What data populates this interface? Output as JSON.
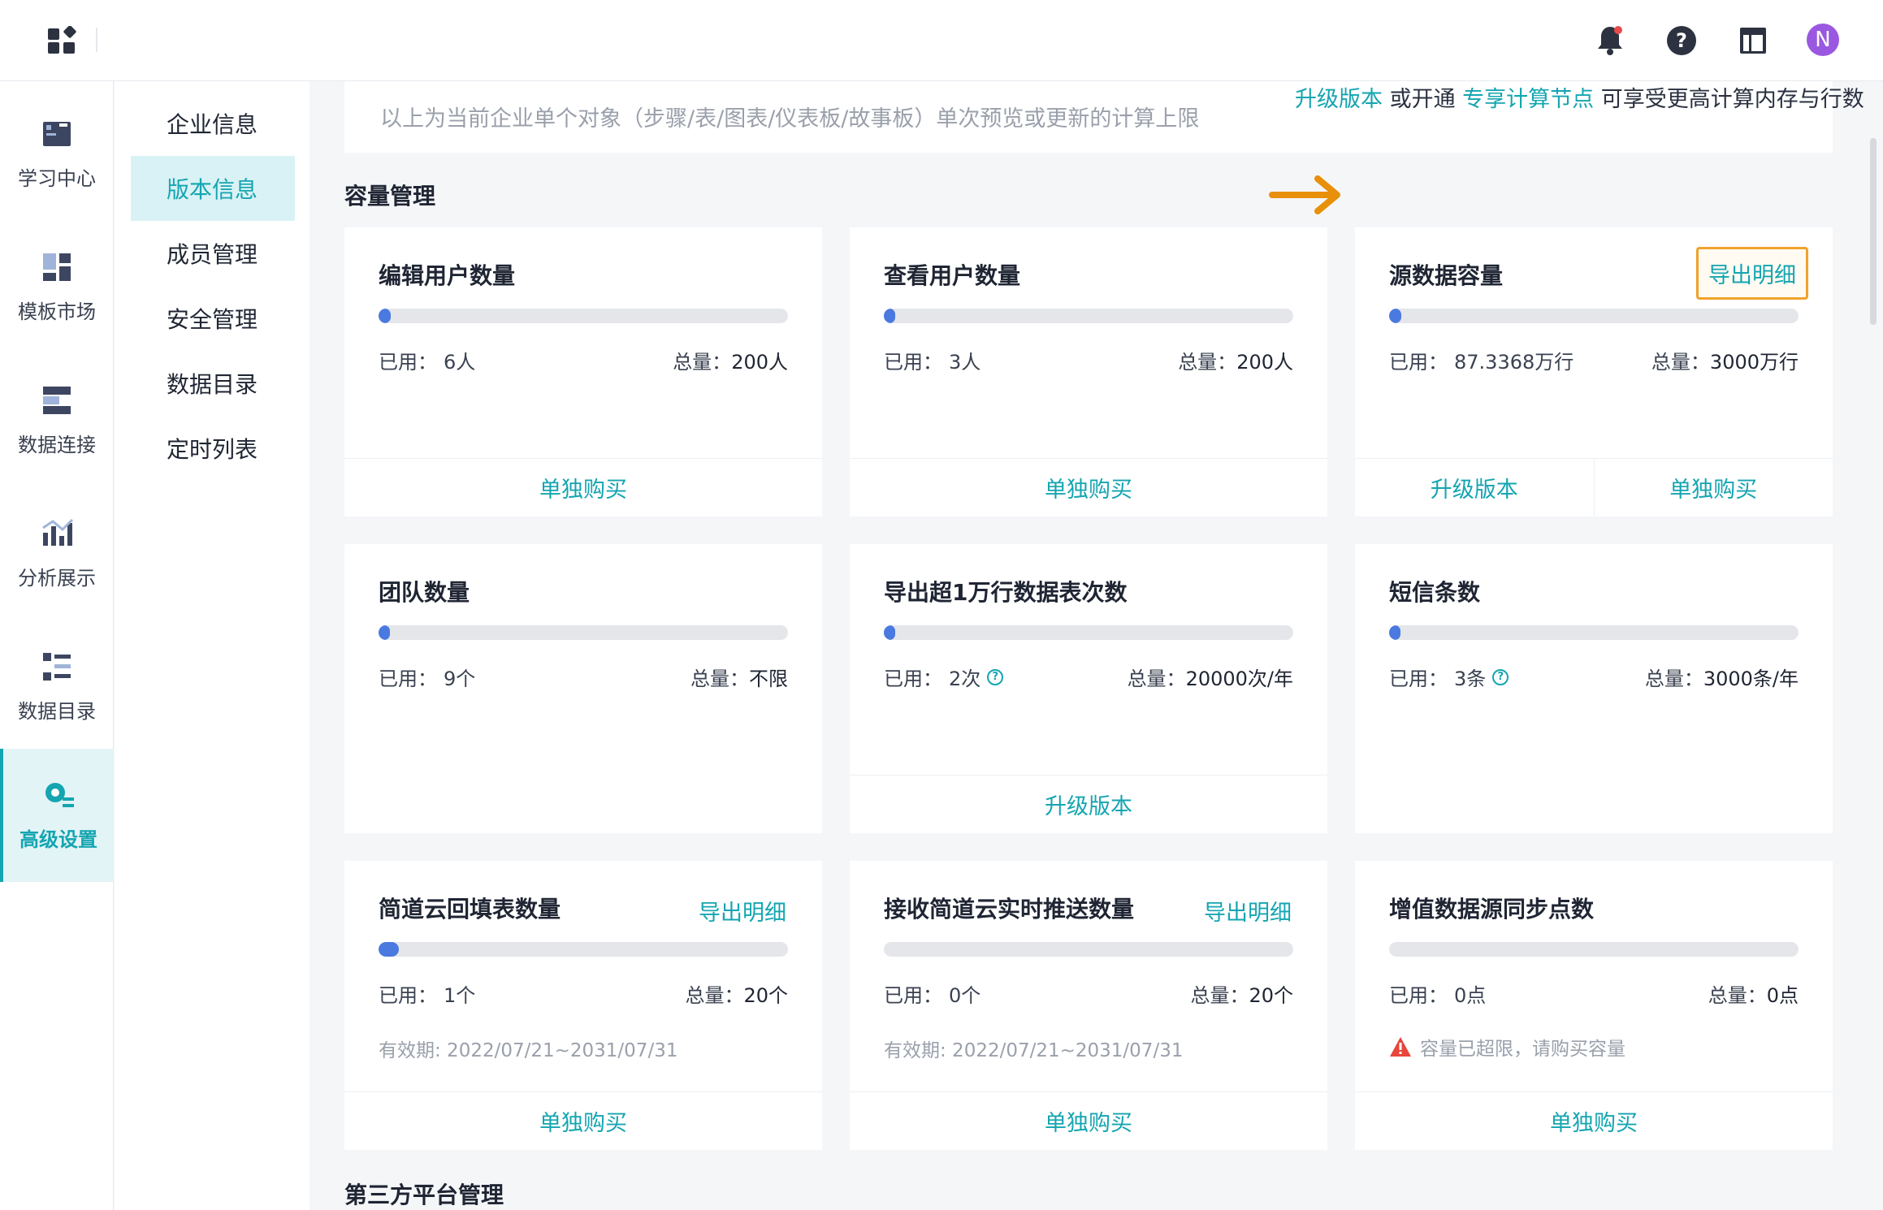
{
  "topbar": {
    "avatar_letter": "N"
  },
  "rail": {
    "items": [
      {
        "label": "学习中心",
        "icon": "book-icon"
      },
      {
        "label": "模板市场",
        "icon": "template-icon"
      },
      {
        "label": "数据连接",
        "icon": "connection-icon"
      },
      {
        "label": "分析展示",
        "icon": "chart-icon"
      },
      {
        "label": "数据目录",
        "icon": "catalog-icon"
      },
      {
        "label": "高级设置",
        "icon": "settings-icon",
        "active": true
      }
    ]
  },
  "subnav": {
    "items": [
      {
        "label": "企业信息"
      },
      {
        "label": "版本信息",
        "active": true
      },
      {
        "label": "成员管理"
      },
      {
        "label": "安全管理"
      },
      {
        "label": "数据目录"
      },
      {
        "label": "定时列表"
      }
    ]
  },
  "notice": {
    "text": "以上为当前企业单个对象（步骤/表/图表/仪表板/故事板）单次预览或更新的计算上限",
    "link1": "升级版本",
    "mid1": " 或开通 ",
    "link2": "专享计算节点",
    "tail": " 可享受更高计算内存与行数"
  },
  "sections": {
    "capacity": "容量管理",
    "third_party": "第三方平台管理"
  },
  "labels": {
    "used": "已用：",
    "total": "总量："
  },
  "cards": [
    {
      "title": "编辑用户数量",
      "used": "6人",
      "total": "200人",
      "progress": 0.03,
      "footer": [
        "单独购买"
      ]
    },
    {
      "title": "查看用户数量",
      "used": "3人",
      "total": "200人",
      "progress": 0.015,
      "footer": [
        "单独购买"
      ]
    },
    {
      "title": "源数据容量",
      "link": "导出明细",
      "used": "87.3368万行",
      "total": "3000万行",
      "progress": 0.03,
      "footer": [
        "升级版本",
        "单独购买"
      ]
    },
    {
      "title": "团队数量",
      "used": "9个",
      "total": "不限",
      "progress": 0.01,
      "footer": []
    },
    {
      "title": "导出超1万行数据表次数",
      "used": "2次",
      "total": "20000次/年",
      "progress": 0.0001,
      "help": true,
      "footer": [
        "升级版本"
      ]
    },
    {
      "title": "短信条数",
      "used": "3条",
      "total": "3000条/年",
      "progress": 0.001,
      "help": true,
      "footer": []
    },
    {
      "title": "简道云回填表数量",
      "link": "导出明细",
      "used": "1个",
      "total": "20个",
      "progress": 0.05,
      "valid": "有效期: 2022/07/21~2031/07/31",
      "footer": [
        "单独购买"
      ]
    },
    {
      "title": "接收简道云实时推送数量",
      "link": "导出明细",
      "used": "0个",
      "total": "20个",
      "progress": 0,
      "valid": "有效期: 2022/07/21~2031/07/31",
      "footer": [
        "单独购买"
      ]
    },
    {
      "title": "增值数据源同步点数",
      "used": "0点",
      "total": "0点",
      "progress": 0,
      "warning": "容量已超限，请购买容量",
      "footer": [
        "单独购买"
      ]
    }
  ]
}
